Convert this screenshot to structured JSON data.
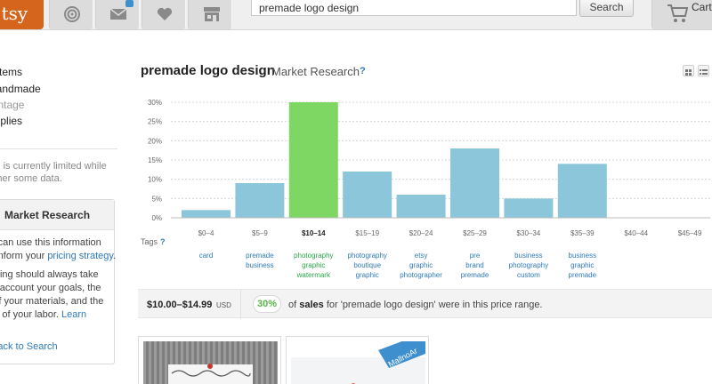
{
  "header": {
    "logo_text": "Etsy",
    "search": {
      "value": "premade logo design",
      "button_label": "Search"
    },
    "cart_label": "Cart",
    "nav_icons": [
      "circles-icon",
      "mail-icon",
      "heart-icon",
      "shop-icon"
    ]
  },
  "sidebar": {
    "categories": [
      "All Items",
      "Handmade",
      "Vintage",
      "Supplies"
    ],
    "limited_note": [
      "Searching is currently limited while",
      "we gather some data."
    ],
    "market_box": {
      "title": "Market Research",
      "lines": [
        "You can use this information",
        "to inform your ",
        "Pricing should always take",
        "into account your goals, the",
        "cost of your materials, and the",
        "value of your labor. "
      ],
      "pricing_link": "pricing strategy",
      "learn_link": "Learn",
      "back_link": "Back to Search"
    }
  },
  "main": {
    "title": "premade logo design",
    "subtitle": "Market Research",
    "help": "?",
    "tags_label": "Tags",
    "tags_help": "?"
  },
  "chart_data": {
    "type": "bar",
    "categories": [
      "$0–4",
      "$5–9",
      "$10–14",
      "$15–19",
      "$20–24",
      "$25–29",
      "$30–34",
      "$35–39",
      "$40–44",
      "$45–49"
    ],
    "values": [
      2,
      9,
      30,
      12,
      6,
      18,
      5,
      14,
      0,
      0
    ],
    "ylim": [
      0,
      30
    ],
    "yticks": [
      0,
      5,
      10,
      15,
      20,
      25,
      30
    ],
    "ytick_suffix": "%",
    "highlight_index": 2,
    "grid": true,
    "colors": {
      "bar": "#8cc6da",
      "highlight": "#7ed663",
      "grid": "#d8d8d8",
      "axis": "#bbbbbb"
    },
    "tags": [
      [
        "card"
      ],
      [
        "premade",
        "business"
      ],
      [
        "photography",
        "graphic",
        "watermark"
      ],
      [
        "photography",
        "boutique",
        "graphic"
      ],
      [
        "etsy",
        "graphic",
        "photographer"
      ],
      [
        "pre",
        "brand",
        "premade"
      ],
      [
        "business",
        "photography",
        "custom"
      ],
      [
        "business",
        "graphic",
        "premade"
      ],
      [],
      []
    ]
  },
  "summary": {
    "range": "$10.00–$14.99",
    "currency": "USD",
    "percent": "30%",
    "text_sales": "sales",
    "text_prefix": "of ",
    "text_suffix": " for 'premade logo design' were in this price range."
  }
}
